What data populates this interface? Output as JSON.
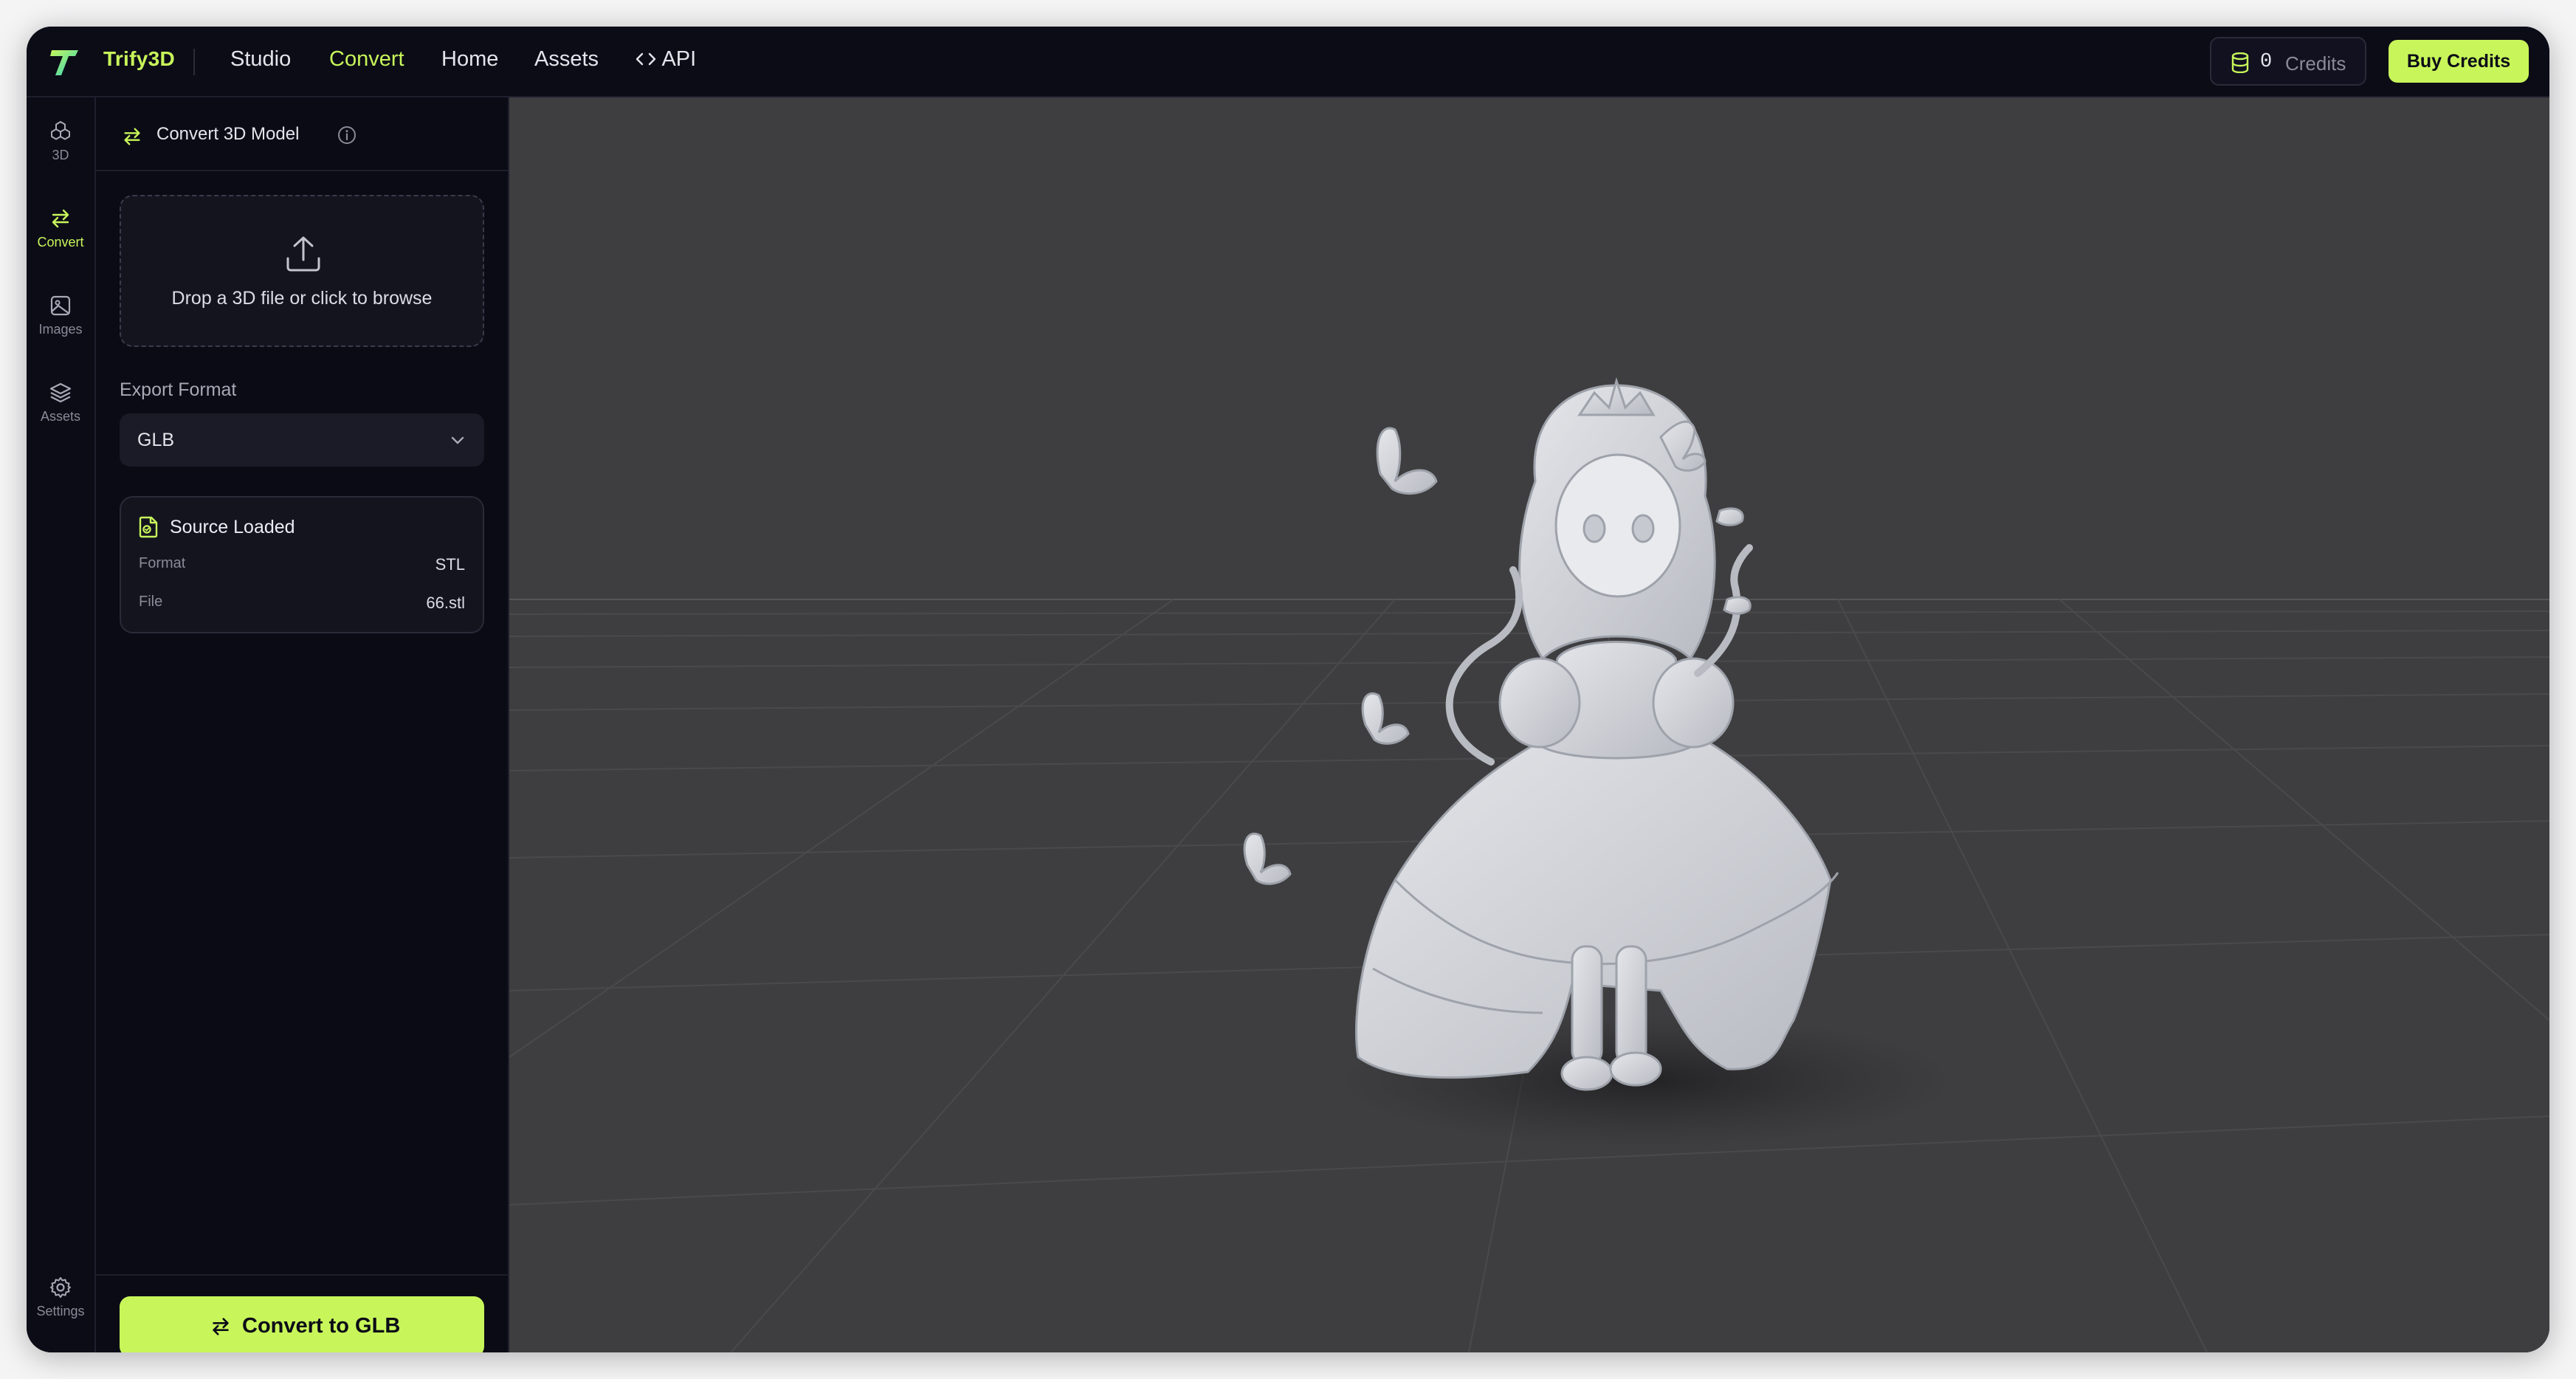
{
  "header": {
    "brand": "Trify3D",
    "nav": [
      {
        "label": "Studio",
        "active": false
      },
      {
        "label": "Convert",
        "active": true
      },
      {
        "label": "Home",
        "active": false
      },
      {
        "label": "Assets",
        "active": false
      },
      {
        "label": "API",
        "active": false
      }
    ],
    "credits_value": "0",
    "credits_label": "Credits",
    "buy_label": "Buy Credits"
  },
  "rail": {
    "items": [
      {
        "label": "3D",
        "icon": "cubes-icon",
        "active": false
      },
      {
        "label": "Convert",
        "icon": "arrows-swap-icon",
        "active": true
      },
      {
        "label": "Images",
        "icon": "image-icon",
        "active": false
      },
      {
        "label": "Assets",
        "icon": "layers-icon",
        "active": false
      }
    ],
    "settings_label": "Settings"
  },
  "panel": {
    "title": "Convert 3D Model",
    "dropzone_text": "Drop a 3D file or click to browse",
    "export_format_label": "Export Format",
    "export_format_value": "GLB",
    "source": {
      "title": "Source Loaded",
      "rows": [
        {
          "key": "Format",
          "value": "STL"
        },
        {
          "key": "File",
          "value": "66.stl"
        }
      ]
    },
    "convert_button": "Convert to GLB"
  },
  "viewport": {
    "background": "#3e3e40",
    "model": "princess figurine with butterflies (gray clay render)"
  },
  "colors": {
    "accent": "#c8f65a",
    "background": "#0b0b16",
    "border": "#1e1e2c"
  }
}
